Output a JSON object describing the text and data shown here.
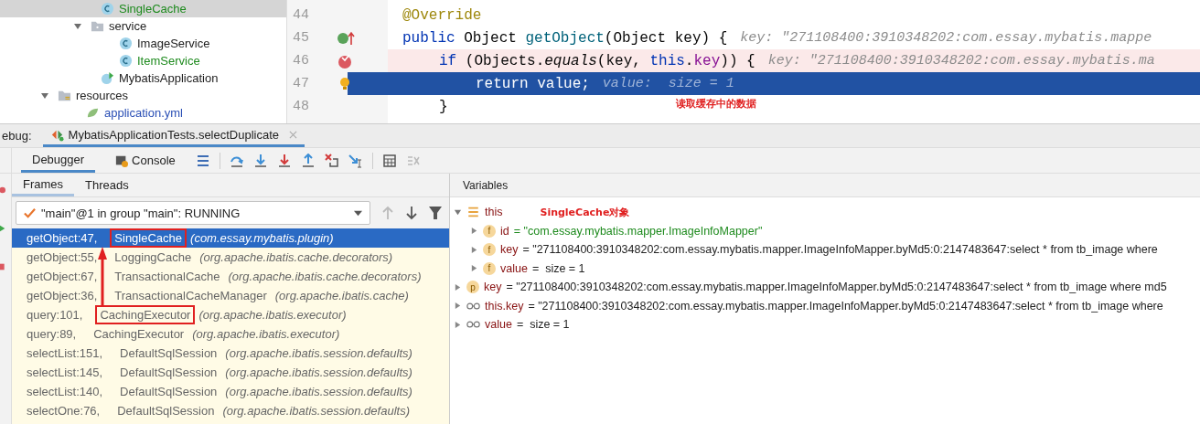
{
  "project_tree": {
    "continued": [
      {
        "label": "SingleCache",
        "kind": "class",
        "color": "#1d8a1d",
        "selected": true
      },
      {
        "label": "service",
        "kind": "package",
        "color": "#222222",
        "selected": false,
        "expanded": true,
        "children": [
          {
            "label": "ImageService",
            "kind": "class",
            "color": "#222222",
            "selected": false
          },
          {
            "label": "ItemService",
            "kind": "class",
            "color": "#1d8a1d",
            "selected": false
          }
        ]
      },
      {
        "label": "MybatisApplication",
        "kind": "app",
        "color": "#222222",
        "selected": false
      }
    ],
    "items": [
      {
        "label": "resources",
        "kind": "folder",
        "color": "#222222",
        "selected": false,
        "expanded": true,
        "children": [
          {
            "label": "application.yml",
            "kind": "file",
            "color": "#2a4fb5",
            "selected": false
          }
        ]
      }
    ]
  },
  "editor": {
    "lines": [
      {
        "number": "44",
        "overrides": false,
        "breakpoint": false,
        "current": false,
        "segments": [
          {
            "kind": "annotation",
            "text": "@Override"
          }
        ]
      },
      {
        "number": "45",
        "overrides": true,
        "breakpoint": false,
        "current": false,
        "segments": [
          {
            "kind": "keyword",
            "text": "public "
          },
          {
            "kind": "plain",
            "text": "Object "
          },
          {
            "kind": "method",
            "text": "getObject"
          },
          {
            "kind": "plain",
            "text": "(Object key) {"
          },
          {
            "kind": "hint",
            "text": "key: \"271108400:3910348202:com.essay.mybatis.mappe"
          }
        ]
      },
      {
        "number": "46",
        "overrides": false,
        "breakpoint": true,
        "current": false,
        "segments": [
          {
            "kind": "keyword",
            "text": "if "
          },
          {
            "kind": "plain",
            "text": "(Objects."
          },
          {
            "kind": "static",
            "text": "equals"
          },
          {
            "kind": "plain",
            "text": "(key, "
          },
          {
            "kind": "keyword",
            "text": "this"
          },
          {
            "kind": "plain",
            "text": "."
          },
          {
            "kind": "field",
            "text": "key"
          },
          {
            "kind": "plain",
            "text": ")) {"
          },
          {
            "kind": "hint",
            "text": "key: \"271108400:3910348202:com.essay.mybatis.ma"
          }
        ]
      },
      {
        "number": "47",
        "overrides": false,
        "breakpoint": false,
        "current": true,
        "segments": [
          {
            "kind": "keyword",
            "text": "return "
          },
          {
            "kind": "plain",
            "text": "value;"
          },
          {
            "kind": "hint",
            "text": "value:  size = 1"
          }
        ]
      },
      {
        "number": "48",
        "overrides": false,
        "breakpoint": false,
        "current": false,
        "segments": [
          {
            "kind": "plain",
            "text": "}"
          }
        ]
      }
    ],
    "note": "读取缓存中的数据"
  },
  "debug_bar": {
    "label": "ebug:",
    "session": "MybatisApplicationTests.selectDuplicate"
  },
  "toolbar": {
    "tabs": [
      {
        "label": "Debugger",
        "selected": true
      },
      {
        "label": "Console",
        "selected": false
      }
    ]
  },
  "frames_panel": {
    "tabs": [
      {
        "label": "Frames",
        "selected": true
      },
      {
        "label": "Threads",
        "selected": false
      }
    ],
    "thread": "\"main\"@1 in group \"main\": RUNNING",
    "frames": [
      {
        "method": "getObject:47,",
        "class": "SingleCache",
        "package": "(com.essay.mybatis.plugin)",
        "selected": true,
        "boxed": true
      },
      {
        "method": "getObject:55,",
        "class": "LoggingCache",
        "package": "(org.apache.ibatis.cache.decorators)",
        "selected": false,
        "boxed": false
      },
      {
        "method": "getObject:67,",
        "class": "TransactionalCache",
        "package": "(org.apache.ibatis.cache.decorators)",
        "selected": false,
        "boxed": false
      },
      {
        "method": "getObject:36,",
        "class": "TransactionalCacheManager",
        "package": "(org.apache.ibatis.cache)",
        "selected": false,
        "boxed": false
      },
      {
        "method": "query:101,",
        "class": "CachingExecutor",
        "package": "(org.apache.ibatis.executor)",
        "selected": false,
        "boxed": true
      },
      {
        "method": "query:89,",
        "class": "CachingExecutor",
        "package": "(org.apache.ibatis.executor)",
        "selected": false,
        "boxed": false
      },
      {
        "method": "selectList:151,",
        "class": "DefaultSqlSession",
        "package": "(org.apache.ibatis.session.defaults)",
        "selected": false,
        "boxed": false
      },
      {
        "method": "selectList:145,",
        "class": "DefaultSqlSession",
        "package": "(org.apache.ibatis.session.defaults)",
        "selected": false,
        "boxed": false
      },
      {
        "method": "selectList:140,",
        "class": "DefaultSqlSession",
        "package": "(org.apache.ibatis.session.defaults)",
        "selected": false,
        "boxed": false
      },
      {
        "method": "selectOne:76,",
        "class": "DefaultSqlSession",
        "package": "(org.apache.ibatis.session.defaults)",
        "selected": false,
        "boxed": false
      }
    ]
  },
  "variables_panel": {
    "title": "Variables",
    "items": [
      {
        "kind": "object",
        "name": "this",
        "note": "SingleCache对象",
        "expanded": true,
        "children": [
          {
            "kind": "field",
            "badge": "f",
            "name": "id",
            "value": "= \"com.essay.mybatis.mapper.ImageInfoMapper\"",
            "color": "#1d8a1d",
            "expanded": false
          },
          {
            "kind": "field",
            "badge": "f",
            "name": "key",
            "value": "= \"271108400:3910348202:com.essay.mybatis.mapper.ImageInfoMapper.byMd5:0:2147483647:select * from tb_image where",
            "color": "#222222",
            "expanded": false
          },
          {
            "kind": "field",
            "badge": "f",
            "name": "value",
            "value": "=  size = 1",
            "color": "#222222",
            "expanded": false
          }
        ]
      },
      {
        "kind": "param",
        "badge": "p",
        "name": "key",
        "value": "= \"271108400:3910348202:com.essay.mybatis.mapper.ImageInfoMapper.byMd5:0:2147483647:select * from tb_image where md5",
        "color": "#222222",
        "expanded": false
      },
      {
        "kind": "watch",
        "name": "this.key",
        "value": "= \"271108400:3910348202:com.essay.mybatis.mapper.ImageInfoMapper.byMd5:0:2147483647:select * from tb_image where",
        "color": "#222222",
        "expanded": false
      },
      {
        "kind": "watch",
        "name": "value",
        "value": "=  size = 1",
        "color": "#222222",
        "expanded": false
      }
    ]
  }
}
